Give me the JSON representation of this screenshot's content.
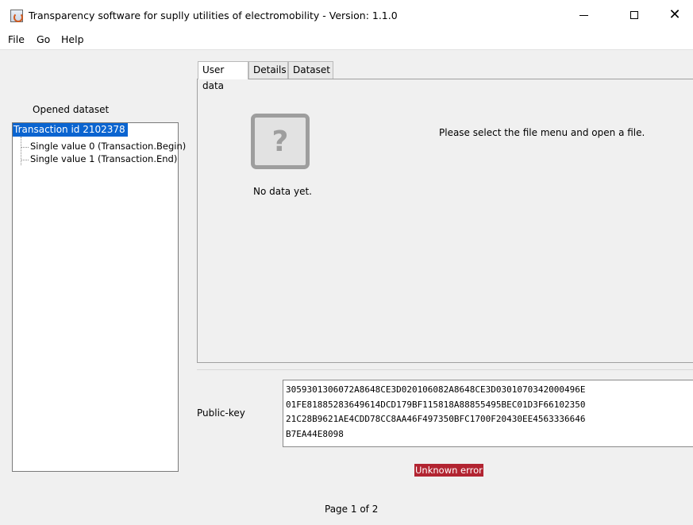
{
  "window": {
    "title": "Transparency software for suplly utilities of electromobility - Version: 1.1.0"
  },
  "menu": {
    "items": [
      "File",
      "Go",
      "Help"
    ]
  },
  "sidebar": {
    "label": "Opened dataset",
    "tree": {
      "root": "Transaction id 2102378",
      "children": [
        "Single value 0 (Transaction.Begin)",
        "Single value 1 (Transaction.End)"
      ]
    }
  },
  "tabs": [
    "User data",
    "Details",
    "Dataset"
  ],
  "content": {
    "placeholder_icon": "question-mark-icon",
    "no_data": "No data yet.",
    "instruction": "Please select the file menu and open a file."
  },
  "public_key": {
    "label": "Public-key",
    "lines": [
      "3059301306072A8648CE3D020106082A8648CE3D0301070342000496E",
      "01FE81885283649614DCD179BF115818A88855495BEC01D3F66102350",
      "21C28B9621AE4CDD78CC8AA46F497350BFC1700F20430EE4563336646",
      "B7EA44E8098"
    ]
  },
  "status": {
    "error": "Unknown error",
    "error_color": "#b22431",
    "page": "Page 1 of 2"
  },
  "colors": {
    "selection": "#0a64d0"
  }
}
